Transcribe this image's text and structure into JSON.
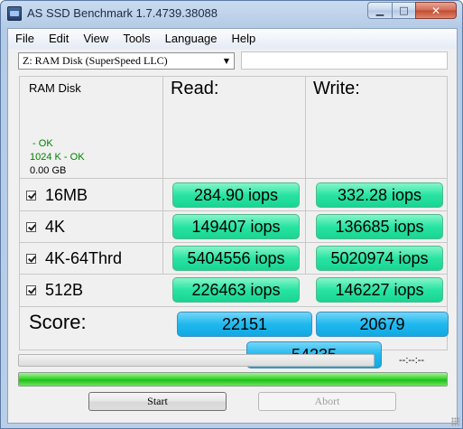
{
  "window": {
    "title": "AS SSD Benchmark 1.7.4739.38088",
    "icons": [
      "app-icon",
      "minimize-icon",
      "maximize-icon",
      "close-icon"
    ]
  },
  "menu": [
    "File",
    "Edit",
    "View",
    "Tools",
    "Language",
    "Help"
  ],
  "drive_select": {
    "value": "Z: RAM Disk (SuperSpeed LLC)"
  },
  "text_field": {
    "value": ""
  },
  "drive_info": {
    "name": "RAM Disk",
    "line1": " - OK",
    "line2": "1024 K - OK",
    "size": "0.00 GB"
  },
  "columns": {
    "read": "Read:",
    "write": "Write:"
  },
  "tests": [
    {
      "name": "16MB",
      "checked": true,
      "read": "284.90 iops",
      "write": "332.28 iops"
    },
    {
      "name": "4K",
      "checked": true,
      "read": "149407 iops",
      "write": "136685 iops"
    },
    {
      "name": "4K-64Thrd",
      "checked": true,
      "read": "5404556 iops",
      "write": "5020974 iops"
    },
    {
      "name": "512B",
      "checked": true,
      "read": "226463 iops",
      "write": "146227 iops"
    }
  ],
  "score": {
    "label": "Score:",
    "read": "22151",
    "write": "20679",
    "total": "54235"
  },
  "progress": {
    "time": "--:--:--",
    "overall_fraction": 1.0
  },
  "buttons": {
    "start": "Start",
    "abort": "Abort",
    "abort_enabled": false
  },
  "colors": {
    "result_green": "#28e4a2",
    "score_blue": "#1fb8ee",
    "progress_green": "#1ec018",
    "status_ok": "#008000"
  }
}
